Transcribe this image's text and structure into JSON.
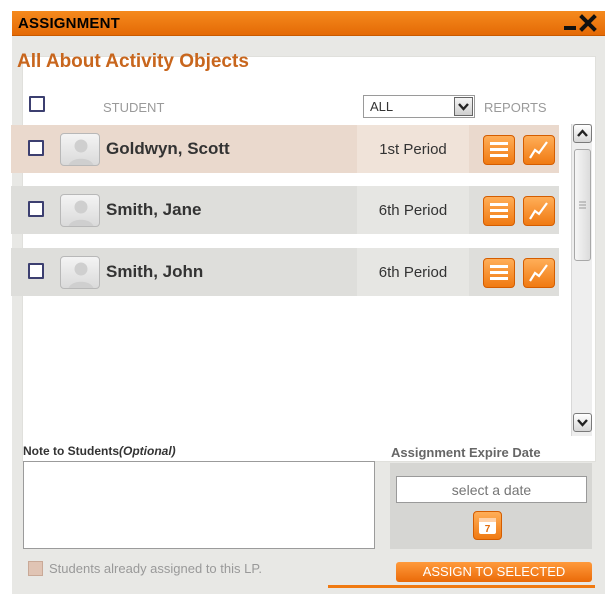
{
  "window": {
    "title": "ASSIGNMENT"
  },
  "activity": {
    "title": "All About Activity Objects"
  },
  "table": {
    "student_header": "STUDENT",
    "filter_value": "ALL",
    "reports_header": "REPORTS",
    "rows": [
      {
        "name": "Goldwyn, Scott",
        "period": "1st Period",
        "selected": true
      },
      {
        "name": "Smith, Jane",
        "period": "6th Period",
        "selected": false
      },
      {
        "name": "Smith, John",
        "period": "6th Period",
        "selected": false
      }
    ]
  },
  "note": {
    "label": "Note to Students",
    "label_optional": "(Optional)",
    "value": ""
  },
  "expire": {
    "label": "Assignment Expire Date",
    "placeholder": "select a date",
    "calendar_glyph": "7"
  },
  "already_assigned": {
    "label": "Students already assigned to this LP."
  },
  "assign_button": {
    "label": "ASSIGN TO SELECTED"
  },
  "colors": {
    "accent": "#f07a12",
    "title_text": "#c8661d",
    "selected_row": "#ead9cd"
  },
  "icons": {
    "minimize": "minimize-icon",
    "close": "close-icon",
    "report": "report-list-icon",
    "chart": "chart-line-icon",
    "calendar": "calendar-icon"
  }
}
